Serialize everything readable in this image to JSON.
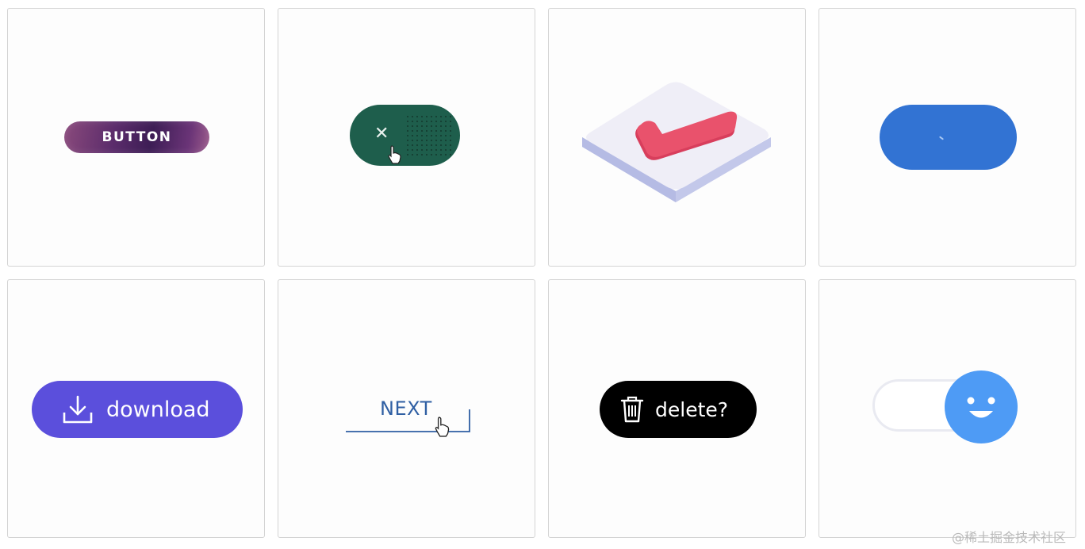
{
  "cards": {
    "gradient": {
      "label": "BUTTON"
    },
    "toggle_x": {
      "icon": "close-icon"
    },
    "isometric_check": {
      "icon": "checkmark-icon"
    },
    "blue_pill": {
      "color": "#3273d3"
    },
    "download": {
      "label": "download",
      "icon": "download-icon"
    },
    "next": {
      "label": "NEXT"
    },
    "delete": {
      "label": "delete?",
      "icon": "trash-icon"
    },
    "smiley_toggle": {
      "icon": "smiley-face-icon",
      "color": "#4e9bf5"
    }
  },
  "watermark": "@稀土掘金技术社区"
}
